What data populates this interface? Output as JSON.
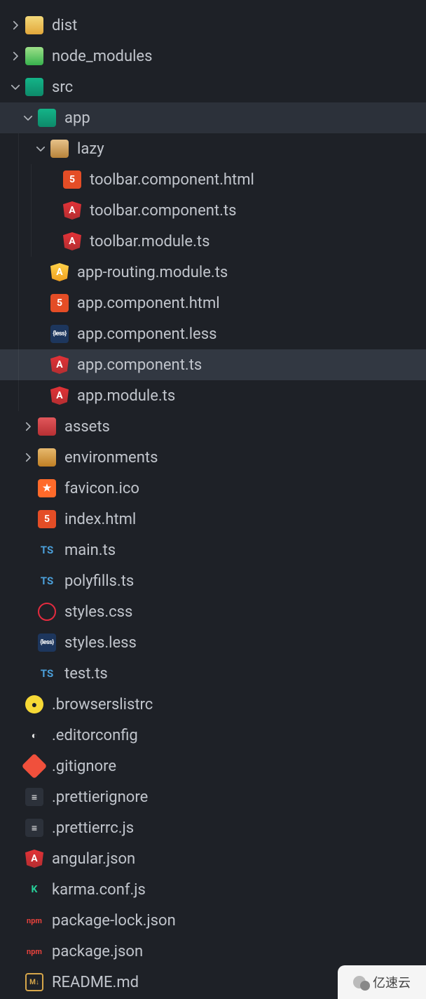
{
  "watermark": "亿速云",
  "tree": [
    {
      "depth": 0,
      "chev": "right",
      "icon": "folder-dist",
      "glyph": "",
      "label": "dist",
      "sel": false
    },
    {
      "depth": 0,
      "chev": "right",
      "icon": "folder-node",
      "glyph": "",
      "label": "node_modules",
      "sel": false
    },
    {
      "depth": 0,
      "chev": "down",
      "icon": "folder-src",
      "glyph": "",
      "label": "src",
      "sel": false
    },
    {
      "depth": 1,
      "chev": "down",
      "icon": "folder-app",
      "glyph": "",
      "label": "app",
      "sel": true
    },
    {
      "depth": 2,
      "chev": "down",
      "icon": "folder-lazy",
      "glyph": "",
      "label": "lazy",
      "sel": false
    },
    {
      "depth": 3,
      "chev": "none",
      "icon": "html",
      "glyph": "5",
      "label": "toolbar.component.html",
      "sel": false
    },
    {
      "depth": 3,
      "chev": "none",
      "icon": "angular-ts",
      "glyph": "A",
      "label": "toolbar.component.ts",
      "sel": false
    },
    {
      "depth": 3,
      "chev": "none",
      "icon": "angular-ts",
      "glyph": "A",
      "label": "toolbar.module.ts",
      "sel": false
    },
    {
      "depth": 2,
      "chev": "none",
      "icon": "angular-mod",
      "glyph": "A",
      "label": "app-routing.module.ts",
      "sel": false
    },
    {
      "depth": 2,
      "chev": "none",
      "icon": "html",
      "glyph": "5",
      "label": "app.component.html",
      "sel": false
    },
    {
      "depth": 2,
      "chev": "none",
      "icon": "less",
      "glyph": "{less}",
      "label": "app.component.less",
      "sel": false
    },
    {
      "depth": 2,
      "chev": "none",
      "icon": "angular-ts",
      "glyph": "A",
      "label": "app.component.ts",
      "sel": true
    },
    {
      "depth": 2,
      "chev": "none",
      "icon": "angular-ts",
      "glyph": "A",
      "label": "app.module.ts",
      "sel": false
    },
    {
      "depth": 1,
      "chev": "right",
      "icon": "folder-assets",
      "glyph": "",
      "label": "assets",
      "sel": false
    },
    {
      "depth": 1,
      "chev": "right",
      "icon": "folder-env",
      "glyph": "",
      "label": "environments",
      "sel": false
    },
    {
      "depth": 1,
      "chev": "none",
      "icon": "fav",
      "glyph": "★",
      "label": "favicon.ico",
      "sel": false
    },
    {
      "depth": 1,
      "chev": "none",
      "icon": "html",
      "glyph": "5",
      "label": "index.html",
      "sel": false
    },
    {
      "depth": 1,
      "chev": "none",
      "icon": "ts",
      "glyph": "TS",
      "label": "main.ts",
      "sel": false
    },
    {
      "depth": 1,
      "chev": "none",
      "icon": "ts",
      "glyph": "TS",
      "label": "polyfills.ts",
      "sel": false
    },
    {
      "depth": 1,
      "chev": "none",
      "icon": "css",
      "glyph": "",
      "label": "styles.css",
      "sel": false
    },
    {
      "depth": 1,
      "chev": "none",
      "icon": "less",
      "glyph": "{less}",
      "label": "styles.less",
      "sel": false
    },
    {
      "depth": 1,
      "chev": "none",
      "icon": "ts",
      "glyph": "TS",
      "label": "test.ts",
      "sel": false
    },
    {
      "depth": 0,
      "chev": "none",
      "icon": "browserslist",
      "glyph": "●",
      "label": ".browserslistrc",
      "sel": false
    },
    {
      "depth": 0,
      "chev": "none",
      "icon": "editorcfg",
      "glyph": "◐",
      "label": ".editorconfig",
      "sel": false
    },
    {
      "depth": 0,
      "chev": "none",
      "icon": "git",
      "glyph": "",
      "label": ".gitignore",
      "sel": false
    },
    {
      "depth": 0,
      "chev": "none",
      "icon": "prettier",
      "glyph": "≡",
      "label": ".prettierignore",
      "sel": false
    },
    {
      "depth": 0,
      "chev": "none",
      "icon": "prettier",
      "glyph": "≡",
      "label": ".prettierrc.js",
      "sel": false
    },
    {
      "depth": 0,
      "chev": "none",
      "icon": "angular-json",
      "glyph": "A",
      "label": "angular.json",
      "sel": false
    },
    {
      "depth": 0,
      "chev": "none",
      "icon": "karma",
      "glyph": "K",
      "label": "karma.conf.js",
      "sel": false
    },
    {
      "depth": 0,
      "chev": "none",
      "icon": "npm",
      "glyph": "npm",
      "label": "package-lock.json",
      "sel": false
    },
    {
      "depth": 0,
      "chev": "none",
      "icon": "npm",
      "glyph": "npm",
      "label": "package.json",
      "sel": false
    },
    {
      "depth": 0,
      "chev": "none",
      "icon": "md",
      "glyph": "M↓",
      "label": "README.md",
      "sel": false
    }
  ]
}
